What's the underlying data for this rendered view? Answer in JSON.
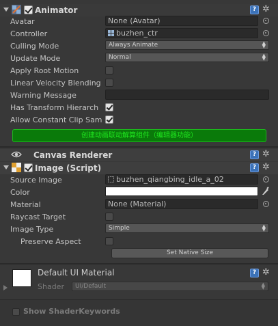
{
  "animator": {
    "title": "Animator",
    "fields": {
      "avatar": {
        "label": "Avatar",
        "value": "None (Avatar)"
      },
      "controller": {
        "label": "Controller",
        "value": "buzhen_ctr"
      },
      "culling_mode": {
        "label": "Culling Mode",
        "value": "Always Animate"
      },
      "update_mode": {
        "label": "Update Mode",
        "value": "Normal"
      },
      "apply_root_motion": {
        "label": "Apply Root Motion",
        "checked": false
      },
      "linear_velocity_blending": {
        "label": "Linear Velocity Blending",
        "checked": false
      },
      "warning_message": {
        "label": "Warning Message",
        "value": ""
      },
      "has_transform_hierarchy": {
        "label": "Has Transform Hierarch",
        "checked": true
      },
      "allow_constant_clip": {
        "label": "Allow Constant Clip Sam",
        "checked": true
      }
    },
    "create_button": "创建动画联动解算组件（编辑器功能）"
  },
  "canvas_renderer": {
    "title": "Canvas Renderer"
  },
  "image_script": {
    "title": "Image (Script)",
    "fields": {
      "source_image": {
        "label": "Source Image",
        "value": "buzhen_qiangbing_idle_a_02"
      },
      "color": {
        "label": "Color",
        "value": "#ffffff"
      },
      "material": {
        "label": "Material",
        "value": "None (Material)"
      },
      "raycast_target": {
        "label": "Raycast Target",
        "checked": false
      },
      "image_type": {
        "label": "Image Type",
        "value": "Simple"
      },
      "preserve_aspect": {
        "label": "Preserve Aspect",
        "checked": false
      }
    },
    "set_native_size": "Set Native Size"
  },
  "material_preview": {
    "title": "Default UI Material",
    "shader_label": "Shader",
    "shader_value": "UI/Default"
  },
  "show_shader_keywords": "Show ShaderKeywords",
  "icons": {
    "help": "?",
    "gear": "✲",
    "eyedropper": "✎",
    "eye": "👁"
  },
  "colors": {
    "background": "#383838",
    "green_button_bg": "#0a7a0a",
    "green_button_text": "#1fe61f",
    "help_blue": "#3b72b8"
  }
}
